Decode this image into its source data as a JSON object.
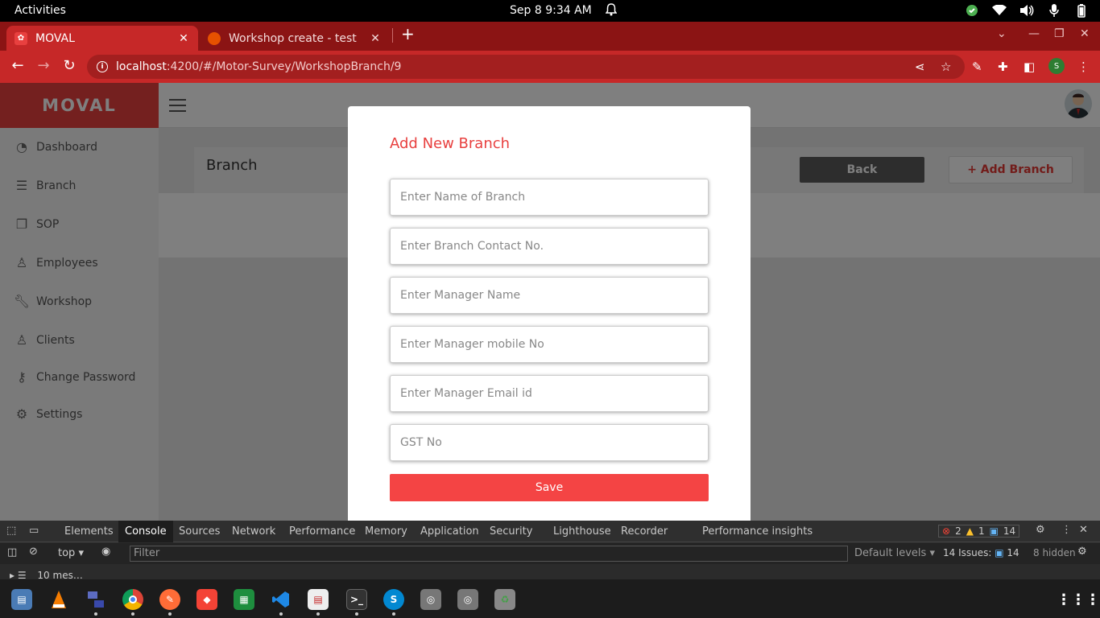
{
  "system": {
    "activities": "Activities",
    "clock": "Sep 8   9:34 AM"
  },
  "browser": {
    "tabs": [
      {
        "title": "MOVAL",
        "active": true
      },
      {
        "title": "Workshop create - test",
        "active": false
      }
    ],
    "url_host": "localhost",
    "url_path": ":4200/#/Motor-Survey/WorkshopBranch/9",
    "profile_initial": "S"
  },
  "app": {
    "logo": "MOVAL",
    "sidebar": {
      "items": [
        {
          "label": "Dashboard",
          "icon": "dashboard-icon"
        },
        {
          "label": "Branch",
          "icon": "list-icon"
        },
        {
          "label": "SOP",
          "icon": "document-icon"
        },
        {
          "label": "Employees",
          "icon": "user-icon"
        },
        {
          "label": "Workshop",
          "icon": "wrench-icon"
        },
        {
          "label": "Clients",
          "icon": "user-icon"
        },
        {
          "label": "Change Password",
          "icon": "key-icon"
        },
        {
          "label": "Settings",
          "icon": "gear-icon"
        }
      ]
    },
    "content": {
      "title": "Branch",
      "back_label": "Back",
      "add_label": "+ Add Branch"
    }
  },
  "modal": {
    "title": "Add New Branch",
    "fields": [
      {
        "placeholder": "Enter Name of Branch"
      },
      {
        "placeholder": "Enter Branch Contact No."
      },
      {
        "placeholder": "Enter Manager Name"
      },
      {
        "placeholder": "Enter Manager mobile No"
      },
      {
        "placeholder": "Enter Manager Email id"
      },
      {
        "placeholder": "GST No"
      }
    ],
    "save_label": "Save"
  },
  "devtools": {
    "tabs": [
      "Elements",
      "Console",
      "Sources",
      "Network",
      "Performance",
      "Memory",
      "Application",
      "Security",
      "Lighthouse",
      "Recorder",
      "Performance insights"
    ],
    "selected_tab": "Console",
    "errors": "2",
    "warnings": "1",
    "messages": "14",
    "context": "top",
    "filter_placeholder": "Filter",
    "levels": "Default levels",
    "issues_label": "14 Issues:",
    "issues_count": "14",
    "hidden": "8 hidden",
    "sidebar_messages": "10 mes…"
  }
}
